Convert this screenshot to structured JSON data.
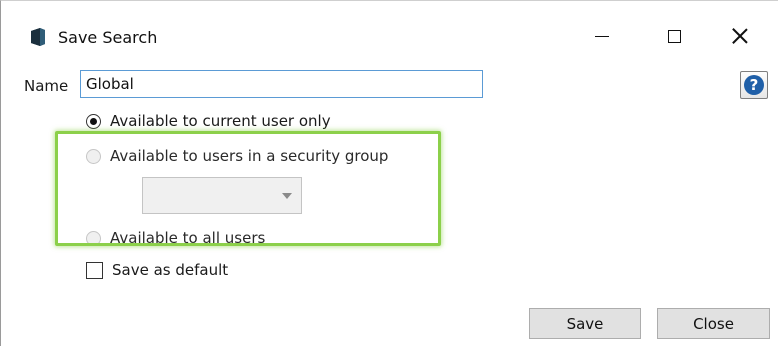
{
  "window": {
    "title": "Save Search",
    "app_icon": "database-icon",
    "controls": [
      "minimize-icon",
      "maximize-icon",
      "close-icon"
    ]
  },
  "form": {
    "name_label": "Name",
    "name_value": "Global",
    "help_icon": "help-icon",
    "help_glyph": "?",
    "options": [
      {
        "label": "Available to current user only",
        "checked": true,
        "enabled": true
      },
      {
        "label": "Available to users in a security group",
        "checked": false,
        "enabled": false
      },
      {
        "label": "Available to all users",
        "checked": false,
        "enabled": false
      }
    ],
    "security_group_select": {
      "value": "",
      "enabled": false
    },
    "save_as_default_label": "Save as default",
    "save_as_default_checked": false
  },
  "buttons": {
    "save": "Save",
    "close": "Close"
  },
  "colors": {
    "highlight": "#8cd04a",
    "input_border": "#5b9bd5",
    "help_icon": "#1f5fa8"
  }
}
